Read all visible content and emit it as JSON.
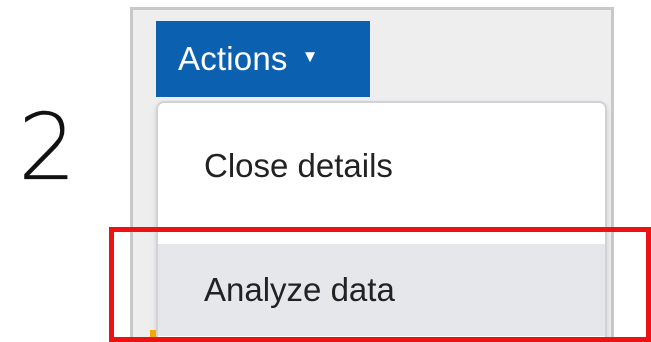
{
  "step": {
    "number": "2"
  },
  "toolbar": {
    "actions_label": "Actions",
    "actions_caret": "▼"
  },
  "menu": {
    "items": [
      {
        "label": "Close details",
        "highlighted": false
      },
      {
        "label": "Analyze data",
        "highlighted": true
      }
    ]
  },
  "colors": {
    "actions_button_bg": "#0b61b0",
    "highlight_box": "#ee1111",
    "menu_hover_bg": "#e6e7ea"
  },
  "icons": {
    "actions_caret": "caret-down-icon"
  }
}
